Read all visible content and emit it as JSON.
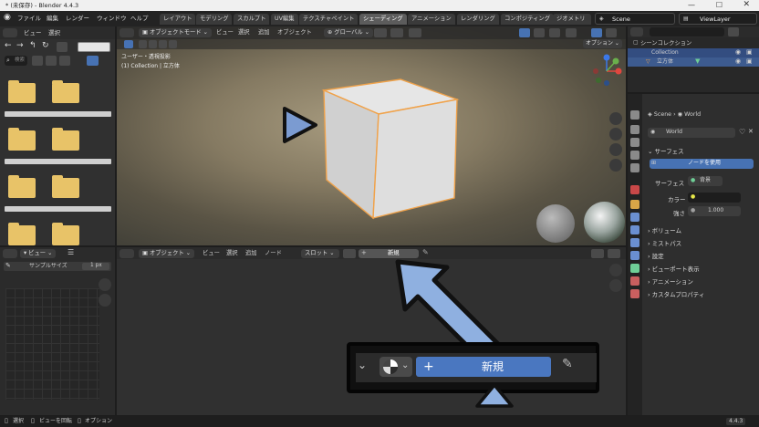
{
  "title_bar": {
    "title": "* (未保存) - Blender 4.4.3"
  },
  "menu": {
    "items": [
      "ファイル",
      "編集",
      "レンダー",
      "ウィンドウ",
      "ヘルプ"
    ]
  },
  "workspace_tabs": [
    "レイアウト",
    "モデリング",
    "スカルプト",
    "UV編集",
    "テクスチャペイント",
    "シェーディング",
    "アニメーション",
    "レンダリング",
    "コンポジティング",
    "ジオメトリ"
  ],
  "active_workspace": "シェーディング",
  "scene": {
    "name": "Scene",
    "view_layer": "ViewLayer"
  },
  "file_browser": {
    "menu": [
      "ビュー",
      "選択"
    ],
    "search_placeholder": "検索"
  },
  "viewport": {
    "mode": "オブジェクトモード",
    "menus": [
      "ビュー",
      "選択",
      "追加",
      "オブジェクト"
    ],
    "transform": "グローバル",
    "options": "オプション",
    "info_line1": "ユーザー・透視投影",
    "info_line2": "(1) Collection | 立方体"
  },
  "image_editor": {
    "menu": "ビュー",
    "sample_size_label": "サンプルサイズ",
    "sample_size_value": "1 px"
  },
  "node_editor": {
    "mode": "オブジェクト",
    "menus": [
      "ビュー",
      "選択",
      "追加",
      "ノード"
    ],
    "slot": "スロット",
    "new_label": "新規"
  },
  "callout": {
    "new_label": "新規",
    "plus": "+"
  },
  "outliner": {
    "scene_collection": "シーンコレクション",
    "collection": "Collection",
    "object": "立方体"
  },
  "properties": {
    "breadcrumb_scene": "Scene",
    "breadcrumb_world": "World",
    "world_name": "World",
    "surface_panel": "サーフェス",
    "use_nodes": "ノードを使用",
    "surface_label": "サーフェス",
    "surface_value": "背景",
    "color_label": "カラー",
    "strength_label": "強さ",
    "strength_value": "1.000",
    "panels": [
      "ボリューム",
      "ミストパス",
      "設定",
      "ビューポート表示",
      "アニメーション",
      "カスタムプロパティ"
    ]
  },
  "status_bar": {
    "items": [
      "選択",
      "ビューを回転",
      "オプション"
    ],
    "version": "4.4.3"
  },
  "colors": {
    "accent": "#4772b3",
    "selection_orange": "#f0a24a",
    "arrow_blue": "#8fb0e0"
  }
}
